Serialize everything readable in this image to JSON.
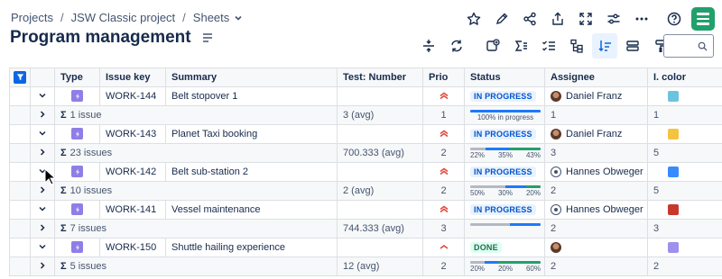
{
  "breadcrumb": {
    "projects": "Projects",
    "project": "JSW Classic project",
    "sheets": "Sheets"
  },
  "page": {
    "title": "Program management"
  },
  "search": {
    "placeholder": ""
  },
  "columns": [
    "Type",
    "Issue key",
    "Summary",
    "Test: Number",
    "Prio",
    "Status",
    "Assignee",
    "I. color"
  ],
  "colors": {
    "accent": "#0c66e4",
    "story": "#8f7ee7",
    "prio_high": "#e2483d",
    "prio_med": "#e2483d",
    "bar_blue": "#1d7afc",
    "bar_green": "#22a06b",
    "bar_grey": "#b3b9c4"
  },
  "rows": [
    {
      "kind": "issue",
      "key": "WORK-144",
      "summary": "Belt stopover 1",
      "test": "",
      "prio": "highest",
      "status": "IN PROGRESS",
      "status_kind": "inprogress",
      "assignee": "Daniel Franz",
      "avatar": "df",
      "color": "#6cc3e0"
    },
    {
      "kind": "group",
      "count": "1 issue",
      "test": "3 (avg)",
      "prio": "1",
      "progress": [
        {
          "pct": 100,
          "c": "blue"
        }
      ],
      "labels": [
        "100% in progress"
      ],
      "assignee": "1",
      "color": "1"
    },
    {
      "kind": "issue",
      "key": "WORK-143",
      "summary": "Planet Taxi booking",
      "test": "",
      "prio": "highest",
      "status": "IN PROGRESS",
      "status_kind": "inprogress",
      "assignee": "Daniel Franz",
      "avatar": "df",
      "color": "#f5c342"
    },
    {
      "kind": "group",
      "count": "23 issues",
      "test": "700.333 (avg)",
      "prio": "2",
      "progress": [
        {
          "pct": 22,
          "c": "grey"
        },
        {
          "pct": 35,
          "c": "blue"
        },
        {
          "pct": 43,
          "c": "green"
        }
      ],
      "labels": [
        "22%",
        "35%",
        "43%"
      ],
      "assignee": "3",
      "color": "5"
    },
    {
      "kind": "issue",
      "key": "WORK-142",
      "summary": "Belt sub-station 2",
      "test": "",
      "prio": "highest",
      "status": "IN PROGRESS",
      "status_kind": "inprogress",
      "assignee": "Hannes Obweger",
      "avatar": "ho",
      "color": "#388bff"
    },
    {
      "kind": "group",
      "count": "10 issues",
      "test": "2 (avg)",
      "prio": "2",
      "progress": [
        {
          "pct": 50,
          "c": "grey"
        },
        {
          "pct": 30,
          "c": "blue"
        },
        {
          "pct": 20,
          "c": "green"
        }
      ],
      "labels": [
        "50%",
        "30%",
        "20%"
      ],
      "assignee": "2",
      "color": "5"
    },
    {
      "kind": "issue",
      "key": "WORK-141",
      "summary": "Vessel maintenance",
      "test": "",
      "prio": "highest",
      "status": "IN PROGRESS",
      "status_kind": "inprogress",
      "assignee": "Hannes Obweger",
      "avatar": "ho",
      "color": "#c9372c"
    },
    {
      "kind": "group",
      "count": "7 issues",
      "test": "744.333 (avg)",
      "prio": "3",
      "progress": [
        {
          "pct": 57,
          "c": "grey"
        },
        {
          "pct": 43,
          "c": "blue"
        }
      ],
      "labels": [
        "",
        ""
      ],
      "assignee": "2",
      "color": "3"
    },
    {
      "kind": "issue",
      "key": "WORK-150",
      "summary": "Shuttle hailing experience",
      "test": "",
      "prio": "high",
      "status": "DONE",
      "status_kind": "done",
      "assignee": "",
      "avatar": "df",
      "color": "#9f8fef"
    },
    {
      "kind": "group",
      "count": "5 issues",
      "test": "12 (avg)",
      "prio": "2",
      "progress": [
        {
          "pct": 20,
          "c": "grey"
        },
        {
          "pct": 20,
          "c": "blue"
        },
        {
          "pct": 60,
          "c": "green"
        }
      ],
      "labels": [
        "20%",
        "20%",
        "60%"
      ],
      "assignee": "2",
      "color": "2"
    }
  ]
}
